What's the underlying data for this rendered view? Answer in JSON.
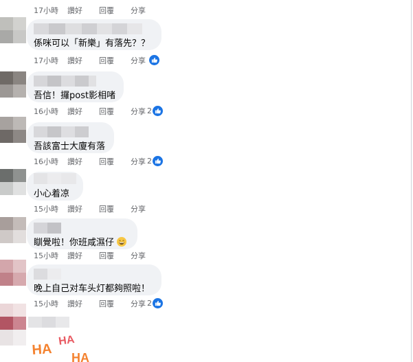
{
  "colors": {
    "bubble": "#f0f2f5",
    "meta_text": "#65676b",
    "like_blue": "#1b74e4",
    "haha_orange": "#f4822f"
  },
  "icons": {
    "like": "thumbs-up-icon",
    "emoji": "grinning-face-icon",
    "sticker": "haha-sticker"
  },
  "actions": {
    "like": "讚好",
    "reply": "回覆",
    "share": "分享"
  },
  "top_meta": {
    "time": "17小時"
  },
  "comments": [
    {
      "text": "係咪可以「新樂」有落先？？",
      "time": "17小時",
      "reaction_count": ""
    },
    {
      "text": "吾信！攞post影相啫",
      "time": "16小時",
      "reaction_count": "2"
    },
    {
      "text": "吾該富士大廈有落",
      "time": "16小時",
      "reaction_count": "2"
    },
    {
      "text": "小心着凉",
      "time": "15小時",
      "reaction_count": ""
    },
    {
      "text": "瞓覺啦！你班咸濕仔",
      "time": "15小時",
      "reaction_count": ""
    },
    {
      "text": "晚上自己对车头灯都夠照啦！",
      "time": "15小時",
      "reaction_count": "2"
    }
  ],
  "sticker": {
    "text_1": "HA",
    "text_2": "HA",
    "text_3": "HA"
  }
}
